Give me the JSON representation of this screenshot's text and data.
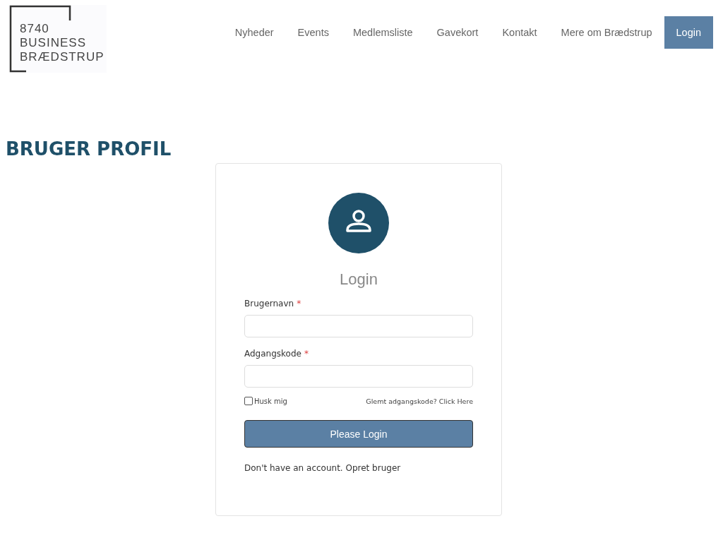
{
  "logo": {
    "lines": [
      "8740",
      "BUSINESS",
      "BRÆDSTRUP"
    ]
  },
  "nav": [
    {
      "label": "Nyheder",
      "selected": false
    },
    {
      "label": "Events",
      "selected": false
    },
    {
      "label": "Medlemsliste",
      "selected": false
    },
    {
      "label": "Gavekort",
      "selected": false
    },
    {
      "label": "Kontakt",
      "selected": false
    },
    {
      "label": "Mere om Brædstrup",
      "selected": false
    },
    {
      "label": "Login",
      "selected": true
    }
  ],
  "page_title": "BRUGER PROFIL",
  "login_card": {
    "heading": "Login",
    "fields": [
      {
        "label": "Brugernavn",
        "required_mark": "*"
      },
      {
        "label": "Adgangskode",
        "required_mark": "*"
      }
    ],
    "remember": {
      "label": "Husk mig",
      "checked": false
    },
    "forgot_link": "Glemt adgangskode? Click Here",
    "submit": "Please Login",
    "signup_text": "Don't have an account. Opret bruger"
  }
}
